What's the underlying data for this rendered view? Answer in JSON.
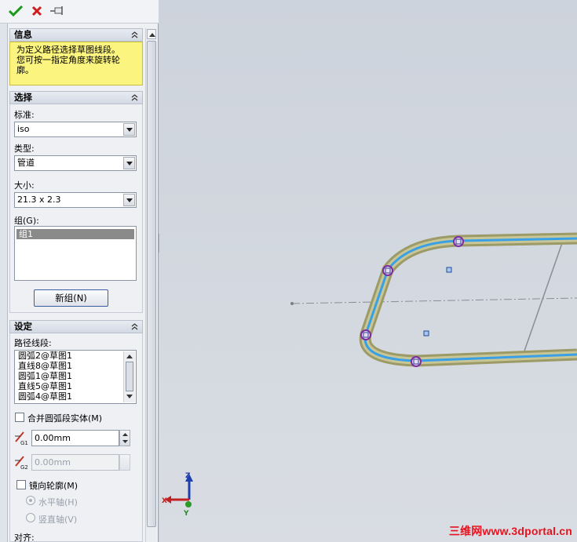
{
  "toolbar": {
    "ok_icon": "check-icon",
    "cancel_icon": "close-icon",
    "pin_icon": "pushpin-icon"
  },
  "info": {
    "title": "信息",
    "message_line1": "为定义路径选择草图线段。",
    "message_line2": "您可按一指定角度来旋转轮",
    "message_line3": "廓。"
  },
  "selection": {
    "title": "选择",
    "standard_label": "标准:",
    "standard_value": "iso",
    "type_label": "类型:",
    "type_value": "管道",
    "size_label": "大小:",
    "size_value": "21.3 x 2.3",
    "group_label": "组(G):",
    "group_items": [
      "组1"
    ],
    "new_group_button": "新组(N)"
  },
  "settings": {
    "title": "设定",
    "path_label": "路径线段:",
    "path_segments": [
      "圆弧2@草图1",
      "直线8@草图1",
      "圆弧1@草图1",
      "直线5@草图1",
      "圆弧4@草图1"
    ],
    "merge_arcs_label": "合并圆弧段实体(M)",
    "merge_arcs_checked": false,
    "gap1_value": "0.00mm",
    "gap2_value": "0.00mm",
    "gap1_icon_label": "G1",
    "gap2_icon_label": "G2",
    "mirror_label": "镜向轮廓(M)",
    "mirror_checked": false,
    "horizontal_axis_label": "水平轴(H)",
    "vertical_axis_label": "竖直轴(V)",
    "align_label": "对齐:"
  },
  "viewport": {
    "triad_x": "X",
    "triad_y": "Y",
    "triad_z": "Z",
    "watermark": "三维网www.3dportal.cn"
  },
  "colors": {
    "pipe_outer": "#9c9a66",
    "pipe_center": "#3aa0e6",
    "info_bg": "#fbf47e",
    "point_ring": "#7a2ba0",
    "watermark": "#e8121f"
  }
}
